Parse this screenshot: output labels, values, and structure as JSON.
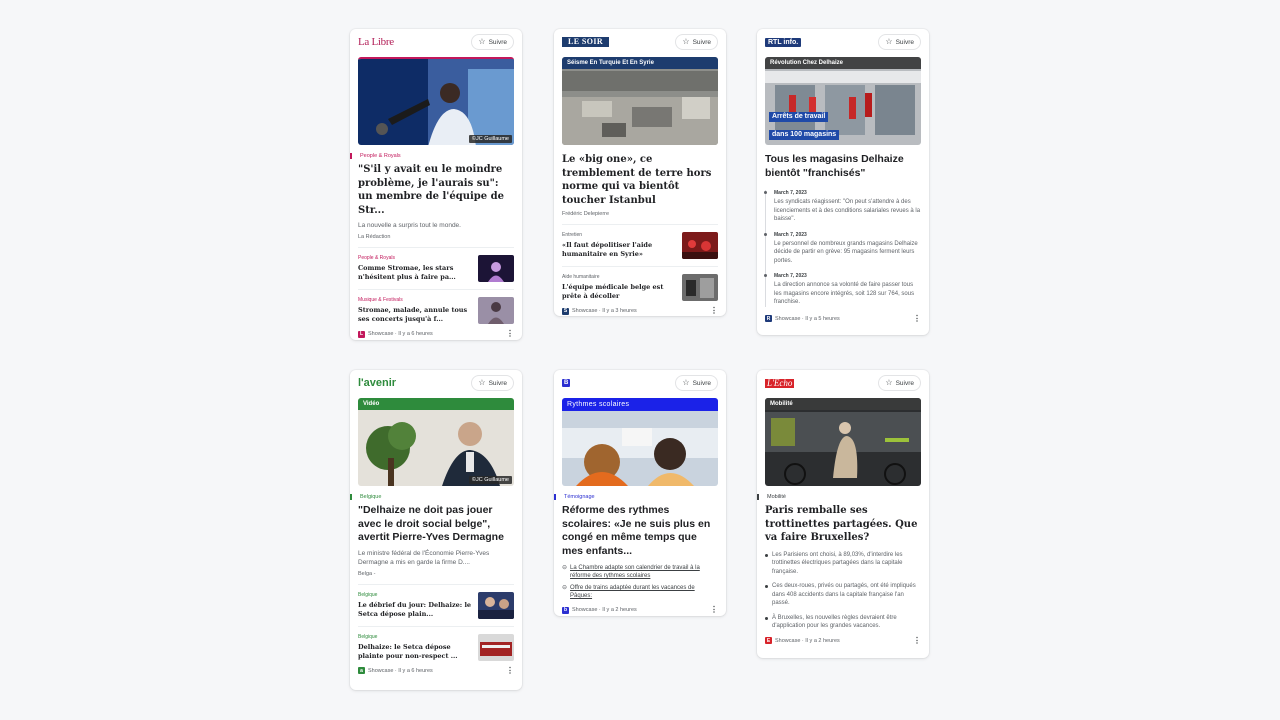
{
  "follow_label": "Suivre",
  "cards": [
    {
      "publisher": "La Libre",
      "hero_credit": "©JC Guillaume",
      "category": "People & Royals",
      "title": "\"S'il y avait eu le moindre problème, je l'aurais su\": un membre de l'équipe de Str...",
      "desc": "La nouvelle a surpris tout le monde.",
      "author": "La Rédaction",
      "subs": [
        {
          "category": "People & Royals",
          "title": "Comme Stromae, les stars n'hésitent plus à faire pa..."
        },
        {
          "category": "Musique & Festivals",
          "title": "Stromae, malade, annule tous ses concerts jusqu'à f..."
        }
      ],
      "footer": "Showcase · Il y a 6 heures",
      "accent": "#c2185b"
    },
    {
      "publisher": "LE SOIR",
      "hero_badge": "Séisme En Turquie Et En Syrie",
      "title": "Le «big one», ce tremblement de terre hors norme qui va bientôt toucher Istanbul",
      "author": "Frédéric Delepierre",
      "subs": [
        {
          "category": "Entretien",
          "title": "«Il faut dépolitiser l'aide humanitaire en Syrie»"
        },
        {
          "category": "Aide humanitaire",
          "title": "L'équipe médicale belge est prête à décoller"
        }
      ],
      "footer": "Showcase · Il y a 3 heures",
      "accent": "#1d3c6e"
    },
    {
      "publisher": "RTL info.",
      "hero_badge": "Révolution Chez Delhaize",
      "hero_overlay": [
        "Arrêts de travail",
        "dans 100 magasins"
      ],
      "title": "Tous les magasins Delhaize bientôt \"franchisés\"",
      "timeline": [
        {
          "date": "March 7, 2023",
          "text": "Les syndicats réagissent: \"On peut s'attendre à des licenciements et à des conditions salariales revues à la baisse\"."
        },
        {
          "date": "March 7, 2023",
          "text": "Le personnel de nombreux grands magasins Delhaize décide de partir en grève: 95 magasins ferment leurs portes."
        },
        {
          "date": "March 7, 2023",
          "text": "La direction annonce sa volonté de faire passer tous les magasins encore intégrés, soit 128 sur 764, sous franchise."
        }
      ],
      "footer": "Showcase · Il y a 5 heures",
      "accent": "#1e3a7a"
    },
    {
      "publisher": "l'avenir",
      "hero_badge": "Vidéo",
      "hero_credit": "©JC Guillaume",
      "category": "Belgique",
      "title": "\"Delhaize ne doit pas jouer avec le droit social belge\", avertit Pierre-Yves Dermagne",
      "desc": "Le ministre fédéral de l'Économie Pierre-Yves Dermagne a mis en garde la firme D....",
      "author": "Belga -",
      "subs": [
        {
          "category": "Belgique",
          "title": "Le débrief du jour: Delhaize: le Setca dépose plain..."
        },
        {
          "category": "Belgique",
          "title": "Delhaize: le Setca dépose plainte pour non-respect ..."
        }
      ],
      "footer": "Showcase · Il y a 6 heures",
      "accent": "#2e8b3c"
    },
    {
      "publisher": "B",
      "hero_badge": "Rythmes scolaires",
      "category": "Témoignage",
      "title": "Réforme des rythmes scolaires: «Je ne suis plus en congé en même temps que mes enfants...",
      "links": [
        "La Chambre adapte son calendrier de travail à la réforme des rythmes scolaires",
        "Offre de trains adaptée durant les vacances de Pâques:"
      ],
      "footer": "Showcase · Il y a 2 heures",
      "accent": "#2b2fd1"
    },
    {
      "publisher": "L'Echo",
      "hero_badge": "Mobilité",
      "category": "Mobilité",
      "title": "Paris remballe ses trottinettes partagées. Que va faire Bruxelles?",
      "bullets": [
        "Les Parisiens ont choisi, à 89,03%, d'interdire les trottinettes électriques partagées dans la capitale française.",
        "Ces deux-roues, privés ou partagés, ont été impliqués dans 408 accidents dans la capitale française l'an passé.",
        "À Bruxelles, les nouvelles règles devraient être d'application pour les grandes vacances."
      ],
      "footer": "Showcase · Il y a 2 heures",
      "accent": "#d8232a"
    }
  ]
}
